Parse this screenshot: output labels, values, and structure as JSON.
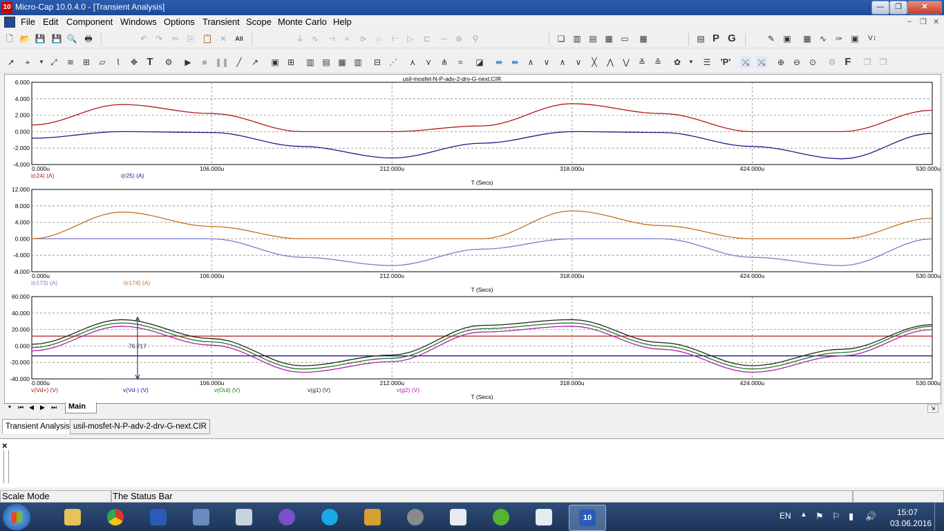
{
  "window": {
    "title": "Micro-Cap 10.0.4.0 - [Transient Analysis]",
    "logo_text": "10",
    "minimize": "—",
    "maximize": "❐",
    "close": "✕"
  },
  "menu": {
    "items": [
      "File",
      "Edit",
      "Component",
      "Windows",
      "Options",
      "Transient",
      "Scope",
      "Monte Carlo",
      "Help"
    ]
  },
  "mdi": {
    "minimize": "‒",
    "restore": "❐",
    "close": "✕"
  },
  "toolbar2": {
    "text_tool": "T",
    "p_btn": "P",
    "g_btn": "G",
    "f_btn": "F",
    "pp_btn": "'P'"
  },
  "plot": {
    "file_title": "usil-mosfet-N-P-adv-2-drv-G-next.CIR",
    "time_ticks": [
      "0.000u",
      "106.000u",
      "212.000u",
      "318.000u",
      "424.000u",
      "530.000u"
    ],
    "xlabel": "T (Secs)",
    "panels": [
      {
        "yticks": [
          "6.000",
          "4.000",
          "2.000",
          "0.000",
          "-2.000",
          "-4.000"
        ],
        "traces": [
          "i(r24) (A)",
          "i(r25) (A)"
        ]
      },
      {
        "yticks": [
          "12.000",
          "8.000",
          "4.000",
          "0.000",
          "-4.000",
          "-8.000"
        ],
        "traces": [
          "i(r173) (A)",
          "i(r174) (A)"
        ]
      },
      {
        "yticks": [
          "60.000",
          "40.000",
          "20.000",
          "0.000",
          "-20.000",
          "-40.000"
        ],
        "traces": [
          "v(Vd+) (V)",
          "v(Vd-) (V)",
          "v(Out) (V)",
          "v(g1) (V)",
          "v(g2) (V)"
        ]
      }
    ],
    "measurement": "76.717"
  },
  "colors": {
    "red": "#b01818",
    "blue": "#1a1a8c",
    "orange": "#c8701c",
    "lavender": "#7a78d0",
    "green": "#1a7a1a",
    "magenta": "#b01cb0",
    "dark": "#222222"
  },
  "chart_data": [
    {
      "type": "line",
      "x": [
        0,
        53,
        106,
        159,
        212,
        265,
        318,
        371,
        424,
        477,
        530
      ],
      "ylim": [
        -4,
        6
      ],
      "series": [
        {
          "name": "i(r24) (A)",
          "values": [
            0.8,
            3.3,
            2.2,
            0.0,
            0.0,
            0.7,
            3.4,
            2.2,
            0.0,
            0.0,
            2.6
          ]
        },
        {
          "name": "i(r25) (A)",
          "values": [
            -0.8,
            0.0,
            -0.1,
            -1.8,
            -3.2,
            -1.4,
            0.0,
            -0.1,
            -1.8,
            -3.3,
            -0.2
          ]
        }
      ]
    },
    {
      "type": "line",
      "x": [
        0,
        53,
        106,
        159,
        212,
        265,
        318,
        371,
        424,
        477,
        530
      ],
      "ylim": [
        -8,
        12
      ],
      "series": [
        {
          "name": "i(r173) (A)",
          "values": [
            0,
            0,
            0,
            -4.5,
            -6.5,
            -2.5,
            0,
            0,
            -4.5,
            -6.5,
            0
          ]
        },
        {
          "name": "i(r174) (A)",
          "values": [
            0,
            6.5,
            3.0,
            0,
            0,
            0,
            6.8,
            3.2,
            0,
            0,
            5.0
          ]
        }
      ]
    },
    {
      "type": "line",
      "x": [
        0,
        53,
        106,
        159,
        212,
        265,
        318,
        371,
        424,
        477,
        530
      ],
      "ylim": [
        -40,
        60
      ],
      "series": [
        {
          "name": "v(Vd+) (V)",
          "values": [
            12,
            12,
            12,
            12,
            12,
            12,
            12,
            12,
            12,
            12,
            12
          ]
        },
        {
          "name": "v(Vd-) (V)",
          "values": [
            -12,
            -12,
            -12,
            -12,
            -12,
            -12,
            -12,
            -12,
            -12,
            -12,
            -12
          ]
        },
        {
          "name": "v(Out) (V)",
          "values": [
            -2,
            28,
            5,
            -28,
            -15,
            21,
            28,
            0,
            -28,
            -8,
            24
          ]
        },
        {
          "name": "v(g1) (V)",
          "values": [
            2,
            32,
            9,
            -24,
            -11,
            25,
            32,
            4,
            -24,
            -4,
            26
          ]
        },
        {
          "name": "v(g2) (V)",
          "values": [
            -6,
            24,
            1,
            -32,
            -19,
            17,
            24,
            -4,
            -32,
            -12,
            20
          ]
        }
      ]
    }
  ],
  "sheet_tabs": {
    "main": "Main"
  },
  "doc_tabs": [
    "Transient Analysis",
    "usil-mosfet-N-P-adv-2-drv-G-next.CIR"
  ],
  "output_close": "×",
  "status": {
    "mode": "Scale Mode",
    "text": "The Status Bar"
  },
  "taskbar": {
    "lang": "EN",
    "time": "15:07",
    "date": "03.06.2016",
    "apps": [
      "explorer",
      "chrome",
      "app3",
      "app4",
      "calculator",
      "viber",
      "skype",
      "app8",
      "app9",
      "app10",
      "utorrent",
      "app12",
      "microcap"
    ]
  }
}
